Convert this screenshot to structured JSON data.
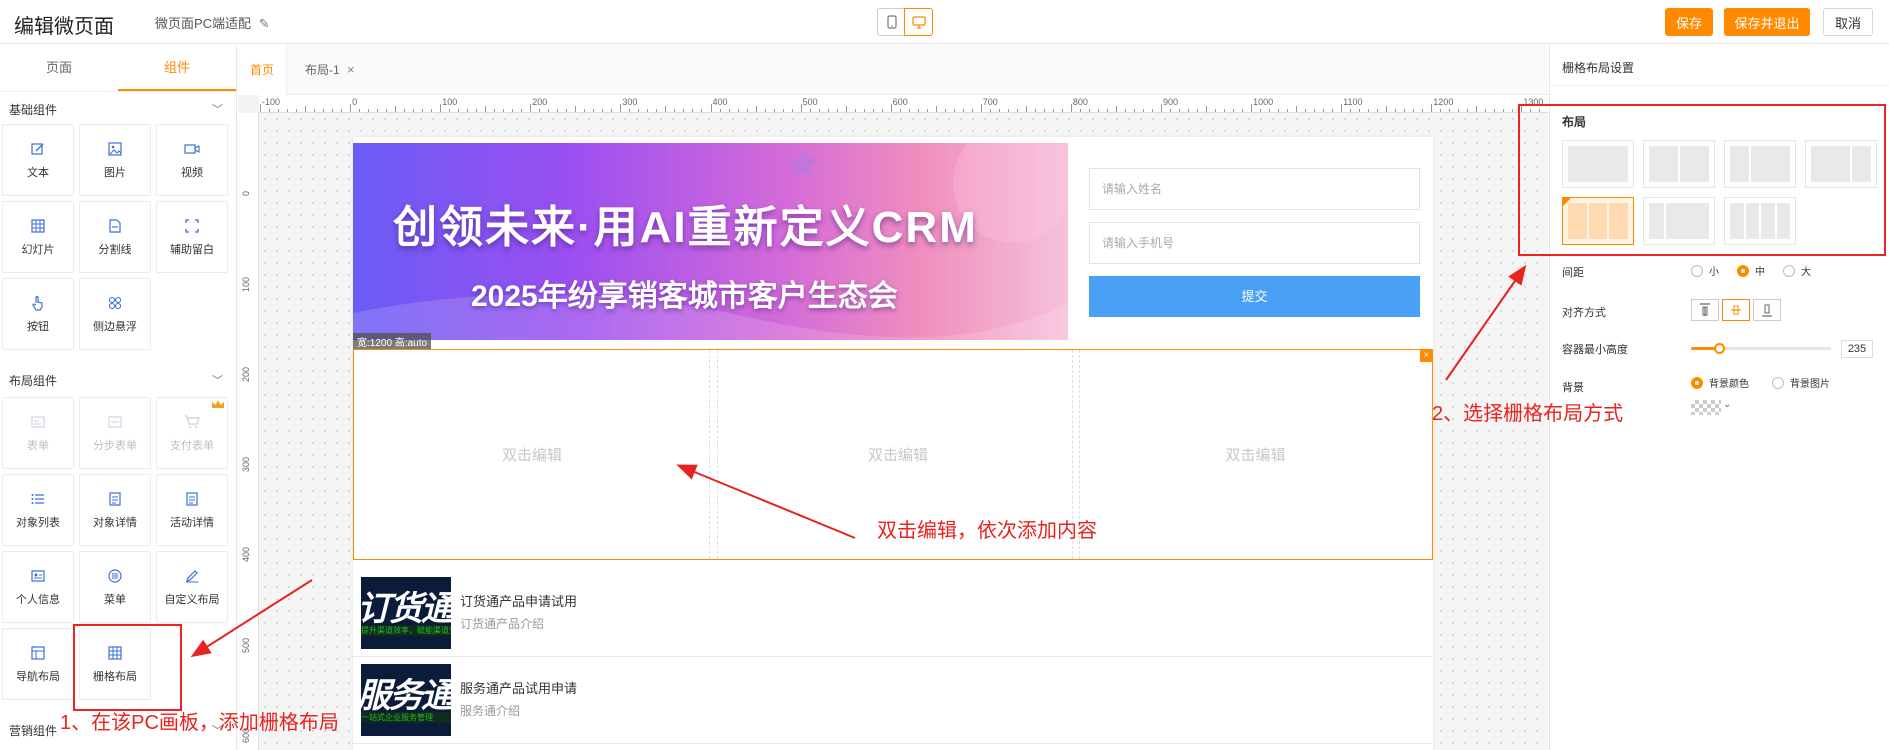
{
  "header": {
    "title": "编辑微页面",
    "subtitle": "微页面PC端适配",
    "save": "保存",
    "save_exit": "保存并退出",
    "cancel": "取消"
  },
  "left_panel": {
    "tabs": [
      "页面",
      "组件"
    ],
    "active_tab": "组件",
    "sections": {
      "basic": {
        "title": "基础组件",
        "items": [
          "文本",
          "图片",
          "视频",
          "幻灯片",
          "分割线",
          "辅助留白",
          "按钮",
          "侧边悬浮"
        ]
      },
      "layout": {
        "title": "布局组件",
        "items": [
          "表单",
          "分步表单",
          "支付表单",
          "对象列表",
          "对象详情",
          "活动详情",
          "个人信息",
          "菜单",
          "自定义布局",
          "导航布局",
          "栅格布局"
        ]
      },
      "marketing": {
        "title": "营销组件"
      }
    }
  },
  "canvas": {
    "tabs": [
      "首页",
      "布局-1"
    ],
    "ruler_x": [
      "-100",
      "0",
      "100",
      "200",
      "300",
      "400",
      "500",
      "600",
      "700",
      "800",
      "900",
      "1000",
      "1100",
      "1200",
      "1300"
    ],
    "ruler_y": [
      "0",
      "100",
      "200",
      "300",
      "400",
      "500",
      "600"
    ],
    "banner": {
      "line1": "创领未来·用AI重新定义CRM",
      "line2": "2025年纷享销客城市客户生态会"
    },
    "size_tag": "宽:1200 高:auto",
    "form": {
      "name_placeholder": "请输入姓名",
      "phone_placeholder": "请输入手机号",
      "submit": "提交"
    },
    "grid_placeholder": "双击编辑",
    "list": [
      {
        "title": "订货通产品申请试用",
        "desc": "订货通产品介绍",
        "thumb": "订货通",
        "thumb_sub": "提升渠道效率，赋能渠道生态"
      },
      {
        "title": "服务通产品试用申请",
        "desc": "服务通介绍",
        "thumb": "服务通",
        "thumb_sub": "一站式企业服务管理"
      }
    ]
  },
  "right_panel": {
    "title": "栅格布局设置",
    "layout_label": "布局",
    "spacing_label": "间距",
    "spacing_options": [
      "小",
      "中",
      "大"
    ],
    "spacing_selected": "中",
    "align_label": "对齐方式",
    "min_height_label": "容器最小高度",
    "min_height_value": "235",
    "min_height_fraction": 0.2,
    "bg_label": "背景",
    "bg_options": [
      "背景颜色",
      "背景图片"
    ],
    "bg_selected": "背景颜色"
  },
  "annotations": {
    "step1": "1、在该PC画板，添加栅格布局",
    "step2": "2、选择栅格布局方式",
    "step3": "双击编辑，依次添加内容"
  },
  "colors": {
    "accent": "#ff8a00",
    "annotation": "#e8231f",
    "submit": "#4aa0f5"
  }
}
